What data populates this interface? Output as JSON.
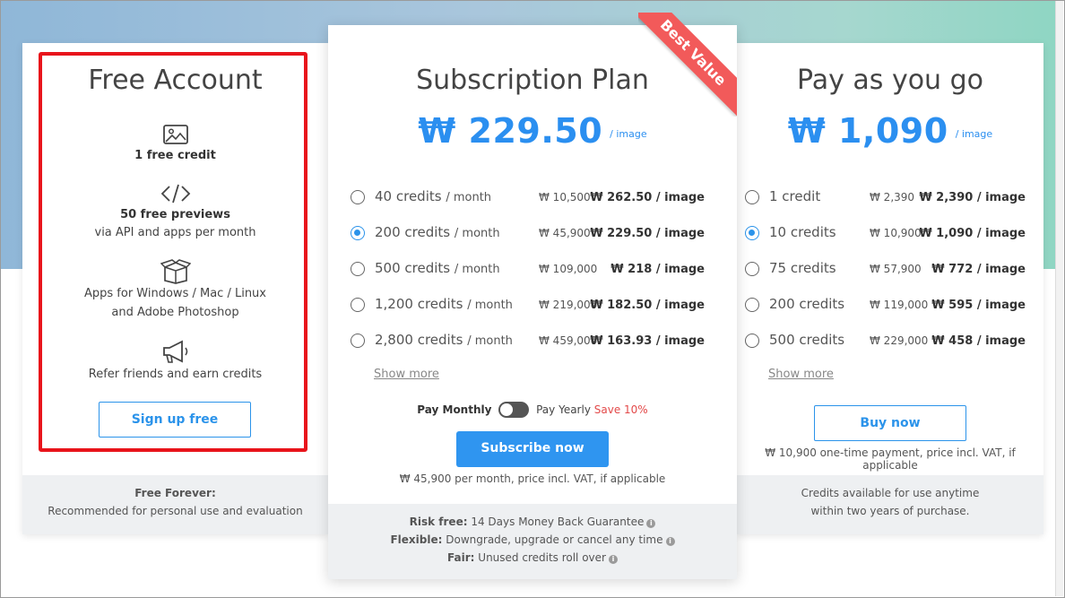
{
  "colors": {
    "accent": "#2b93ea",
    "highlight": "#e8141b",
    "ribbon": "#f25a5a",
    "save": "#e34a4a"
  },
  "free": {
    "title": "Free Account",
    "features": [
      {
        "icon": "image-icon",
        "line1": "1 free credit",
        "line2": ""
      },
      {
        "icon": "code-icon",
        "line1": "50 free previews",
        "line2": "via API and apps per month"
      },
      {
        "icon": "box-icon",
        "line1": "Apps for Windows / Mac / Linux",
        "line2": "and Adobe Photoshop"
      },
      {
        "icon": "megaphone-icon",
        "line1": "Refer friends and earn credits",
        "line2": ""
      }
    ],
    "button": "Sign up free",
    "foot_title": "Free Forever:",
    "foot_text": "Recommended for personal use and evaluation"
  },
  "sub": {
    "ribbon": "Best Value",
    "title": "Subscription Plan",
    "price": "₩ 229.50",
    "per": "/ image",
    "options": [
      {
        "credits": "40 credits",
        "period": "/ month",
        "total": "₩ 10,500",
        "unit": "₩ 262.50 / image",
        "selected": false
      },
      {
        "credits": "200 credits",
        "period": "/ month",
        "total": "₩ 45,900",
        "unit": "₩ 229.50 / image",
        "selected": true
      },
      {
        "credits": "500 credits",
        "period": "/ month",
        "total": "₩ 109,000",
        "unit": "₩ 218 / image",
        "selected": false
      },
      {
        "credits": "1,200 credits",
        "period": "/ month",
        "total": "₩ 219,000",
        "unit": "₩ 182.50 / image",
        "selected": false
      },
      {
        "credits": "2,800 credits",
        "period": "/ month",
        "total": "₩ 459,000",
        "unit": "₩ 163.93 / image",
        "selected": false
      }
    ],
    "show_more": "Show more",
    "pay_monthly": "Pay Monthly",
    "pay_yearly": "Pay Yearly",
    "save": "Save 10%",
    "button": "Subscribe now",
    "note": "₩ 45,900 per month, price incl. VAT, if applicable",
    "foot": [
      {
        "label": "Risk free:",
        "text": "14 Days Money Back Guarantee"
      },
      {
        "label": "Flexible:",
        "text": "Downgrade, upgrade or cancel any time"
      },
      {
        "label": "Fair:",
        "text": "Unused credits roll over"
      }
    ]
  },
  "payg": {
    "title": "Pay as you go",
    "price": "₩ 1,090",
    "per": "/ image",
    "options": [
      {
        "credits": "1 credit",
        "total": "₩ 2,390",
        "unit": "₩ 2,390 / image",
        "selected": false
      },
      {
        "credits": "10 credits",
        "total": "₩ 10,900",
        "unit": "₩ 1,090 / image",
        "selected": true
      },
      {
        "credits": "75 credits",
        "total": "₩ 57,900",
        "unit": "₩ 772 / image",
        "selected": false
      },
      {
        "credits": "200 credits",
        "total": "₩ 119,000",
        "unit": "₩ 595 / image",
        "selected": false
      },
      {
        "credits": "500 credits",
        "total": "₩ 229,000",
        "unit": "₩ 458 / image",
        "selected": false
      }
    ],
    "show_more": "Show more",
    "button": "Buy now",
    "note": "₩ 10,900 one-time payment, price incl. VAT, if applicable",
    "foot_line1": "Credits available for use anytime",
    "foot_line2": "within two years of purchase."
  }
}
